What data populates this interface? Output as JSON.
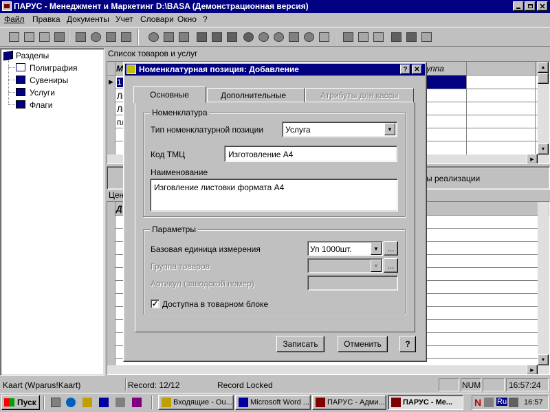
{
  "app": {
    "title": "ПАРУС - Менеджмент и Маркетинг  D:\\BASA (Демонстрационная версия)"
  },
  "menu": [
    "Файл",
    "Правка",
    "Документы",
    "Учет",
    "Словари",
    "Окно",
    "?"
  ],
  "tree": {
    "root": "Разделы",
    "items": [
      "Полиграфия",
      "Сувениры",
      "Услуги",
      "Флаги"
    ]
  },
  "upper_grid": {
    "title": "Список товаров и услуг",
    "col_first": "М",
    "col_group": "уппа",
    "row_first_cells": [
      "1",
      "Ли",
      "Ли",
      "пл"
    ]
  },
  "lower_panel": {
    "tab_visible": "ы реализации",
    "price_label": "Цен",
    "col_first": "Д"
  },
  "dialog": {
    "title": "Номенклатурная позиция: Добавление",
    "tabs": [
      "Основные",
      "Дополнительные",
      "Атрибуты для кассы"
    ],
    "nomenclature_group": "Номенклатура",
    "type_label": "Тип номенклатурной позиции",
    "type_value": "Услуга",
    "code_label": "Код ТМЦ",
    "code_value": "Изготовление А4",
    "name_label": "Наименование",
    "name_value": "Изговление листовки формата А4",
    "params_group": "Параметры",
    "unit_label": "Базовая единица измерения",
    "unit_value": "Уп 1000шт.",
    "group_label": "Группа товаров",
    "article_label": "Артикул (заводской номер)",
    "available_label": "Доступна в товарном блоке",
    "available_checked": true,
    "save_button": "Записать",
    "cancel_button": "Отменить",
    "help_button": "?",
    "ellipsis": "..."
  },
  "statusbar": {
    "user": "Kaart (Wparus!Kaart)",
    "record": "Record: 12/12",
    "lock": "Record Locked",
    "num": "NUM",
    "time": "16:57:24"
  },
  "taskbar": {
    "start": "Пуск",
    "tasks": [
      "Входящие - Ou...",
      "Microsoft Word ...",
      "ПАРУС - Адми...",
      "ПАРУС - Ме..."
    ],
    "tray_n": "N",
    "tray_lang": "Ru",
    "clock": "16:57"
  },
  "colors": {
    "titlebar": "#000080",
    "face": "#c0c0c0",
    "selection": "#000080",
    "desktop": "#008080"
  }
}
